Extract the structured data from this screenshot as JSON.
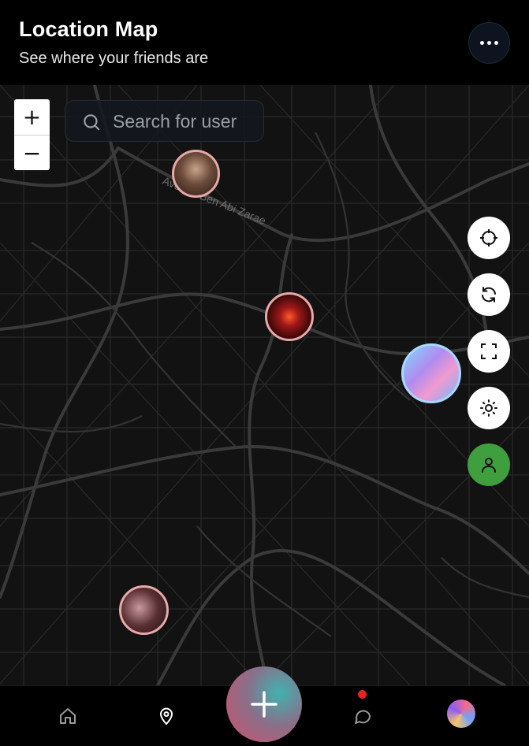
{
  "header": {
    "title": "Location Map",
    "subtitle": "See where your friends are",
    "more_icon": "more-horizontal-icon"
  },
  "map": {
    "street_label": "Avenue Ben Abi Zarae",
    "zoom_in_label": "+",
    "zoom_out_label": "−",
    "search": {
      "placeholder": "Search for user",
      "icon": "search-icon"
    },
    "friends": [
      {
        "name": "friend-1",
        "ring_color": "#e8a8a8"
      },
      {
        "name": "friend-2",
        "ring_color": "#e8a8a8"
      },
      {
        "name": "friend-3",
        "ring_color": "#a8d8ff"
      },
      {
        "name": "friend-4",
        "ring_color": "#e8a8a8"
      }
    ],
    "controls": [
      {
        "name": "locate",
        "icon": "crosshair-icon"
      },
      {
        "name": "refresh",
        "icon": "refresh-icon"
      },
      {
        "name": "fullscreen",
        "icon": "fullscreen-icon"
      },
      {
        "name": "theme",
        "icon": "sun-icon"
      },
      {
        "name": "profile",
        "icon": "user-icon",
        "color": "#3f9f3f"
      }
    ]
  },
  "bottom_nav": {
    "items": [
      {
        "name": "home",
        "icon": "home-icon"
      },
      {
        "name": "map",
        "icon": "map-pin-icon",
        "active": true
      },
      {
        "name": "add",
        "icon": "plus-icon"
      },
      {
        "name": "messages",
        "icon": "chat-bubble-icon",
        "has_notification": true
      },
      {
        "name": "profile",
        "icon": "avatar"
      }
    ],
    "notification_color": "#e32424"
  }
}
